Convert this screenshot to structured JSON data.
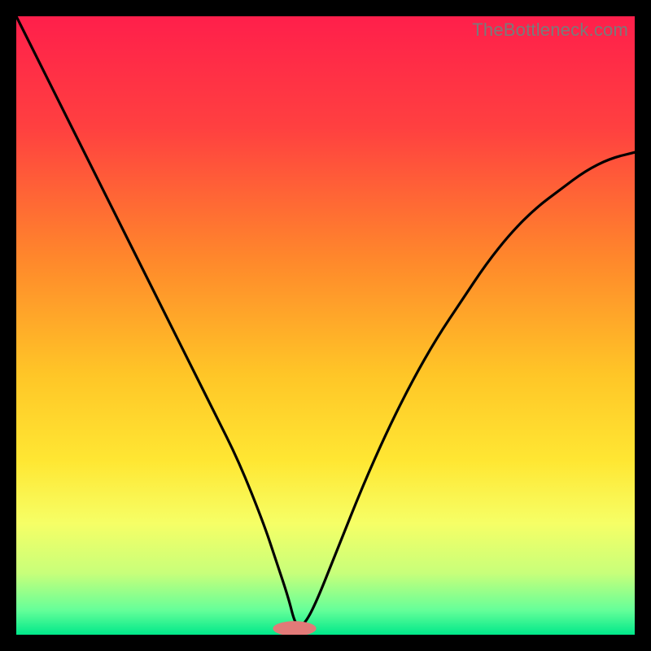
{
  "watermark": "TheBottleneck.com",
  "chart_data": {
    "type": "line",
    "title": "",
    "xlabel": "",
    "ylabel": "",
    "xlim": [
      0,
      100
    ],
    "ylim": [
      0,
      100
    ],
    "gradient_stops": [
      {
        "offset": 0,
        "color": "#ff1f4b"
      },
      {
        "offset": 18,
        "color": "#ff4040"
      },
      {
        "offset": 40,
        "color": "#ff8a2b"
      },
      {
        "offset": 58,
        "color": "#ffc627"
      },
      {
        "offset": 72,
        "color": "#ffe733"
      },
      {
        "offset": 82,
        "color": "#f6ff66"
      },
      {
        "offset": 90,
        "color": "#c8ff7a"
      },
      {
        "offset": 96,
        "color": "#66ff99"
      },
      {
        "offset": 100,
        "color": "#00e88a"
      }
    ],
    "series": [
      {
        "name": "bottleneck-curve",
        "x": [
          0,
          4,
          8,
          12,
          16,
          20,
          24,
          28,
          32,
          36,
          40,
          42,
          44,
          45,
          46,
          48,
          52,
          56,
          60,
          64,
          68,
          72,
          76,
          80,
          84,
          88,
          92,
          96,
          100
        ],
        "y": [
          100,
          92,
          84,
          76,
          68,
          60,
          52,
          44,
          36,
          28,
          18,
          12,
          6,
          2,
          1,
          4,
          14,
          24,
          33,
          41,
          48,
          54,
          60,
          65,
          69,
          72,
          75,
          77,
          78
        ]
      }
    ],
    "marker": {
      "x": 45,
      "y": 1,
      "rx": 3.5,
      "ry": 1.2,
      "color": "#e27a78"
    }
  }
}
